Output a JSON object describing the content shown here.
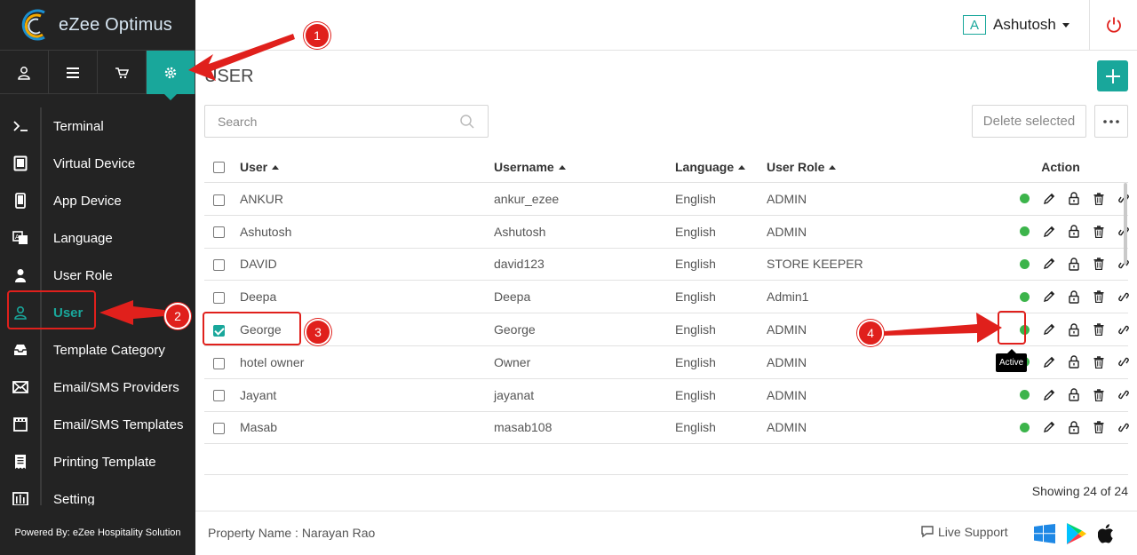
{
  "brand": {
    "name": "eZee Optimus"
  },
  "sidebar": {
    "top_tabs": [
      {
        "icon": "user-icon"
      },
      {
        "icon": "list-icon"
      },
      {
        "icon": "cart-icon"
      },
      {
        "icon": "gear-icon",
        "active": true
      }
    ],
    "items": [
      {
        "label": "Terminal",
        "icon": "terminal-icon"
      },
      {
        "label": "Virtual Device",
        "icon": "tablet-icon"
      },
      {
        "label": "App Device",
        "icon": "phone-icon"
      },
      {
        "label": "Language",
        "icon": "translate-icon"
      },
      {
        "label": "User Role",
        "icon": "user-role-icon"
      },
      {
        "label": "User",
        "icon": "user-icon",
        "active": true
      },
      {
        "label": "Template Category",
        "icon": "inbox-icon"
      },
      {
        "label": "Email/SMS Providers",
        "icon": "envelope-icon"
      },
      {
        "label": "Email/SMS Templates",
        "icon": "film-icon"
      },
      {
        "label": "Printing Template",
        "icon": "receipt-icon"
      },
      {
        "label": "Setting",
        "icon": "settings-icon"
      }
    ],
    "footer": "Powered By: eZee Hospitality Solution"
  },
  "header": {
    "avatar_letter": "A",
    "user_name": "Ashutosh"
  },
  "page": {
    "title": "USER",
    "search_placeholder": "Search",
    "delete_selected": "Delete selected",
    "showing": "Showing 24 of 24"
  },
  "table": {
    "columns": [
      "User",
      "Username",
      "Language",
      "User Role",
      "Action"
    ],
    "rows": [
      {
        "user": "ANKUR",
        "username": "ankur_ezee",
        "language": "English",
        "role": "ADMIN",
        "checked": false
      },
      {
        "user": "Ashutosh",
        "username": "Ashutosh",
        "language": "English",
        "role": "ADMIN",
        "checked": false
      },
      {
        "user": "DAVID",
        "username": "david123",
        "language": "English",
        "role": "STORE KEEPER",
        "checked": false
      },
      {
        "user": "Deepa",
        "username": "Deepa",
        "language": "English",
        "role": "Admin1",
        "checked": false
      },
      {
        "user": "George",
        "username": "George",
        "language": "English",
        "role": "ADMIN",
        "checked": true
      },
      {
        "user": "hotel owner",
        "username": "Owner",
        "language": "English",
        "role": "ADMIN",
        "checked": false
      },
      {
        "user": "Jayant",
        "username": "jayanat",
        "language": "English",
        "role": "ADMIN",
        "checked": false
      },
      {
        "user": "Masab",
        "username": "masab108",
        "language": "English",
        "role": "ADMIN",
        "checked": false
      }
    ]
  },
  "tooltip": "Active",
  "footer": {
    "property": "Property Name : Narayan Rao",
    "live_support": "Live Support"
  },
  "annotations": [
    "1",
    "2",
    "3",
    "4"
  ],
  "colors": {
    "accent": "#19a79b",
    "sidebar_bg": "#232323",
    "status_active": "#3cb44b",
    "annotation": "#e0201c"
  }
}
